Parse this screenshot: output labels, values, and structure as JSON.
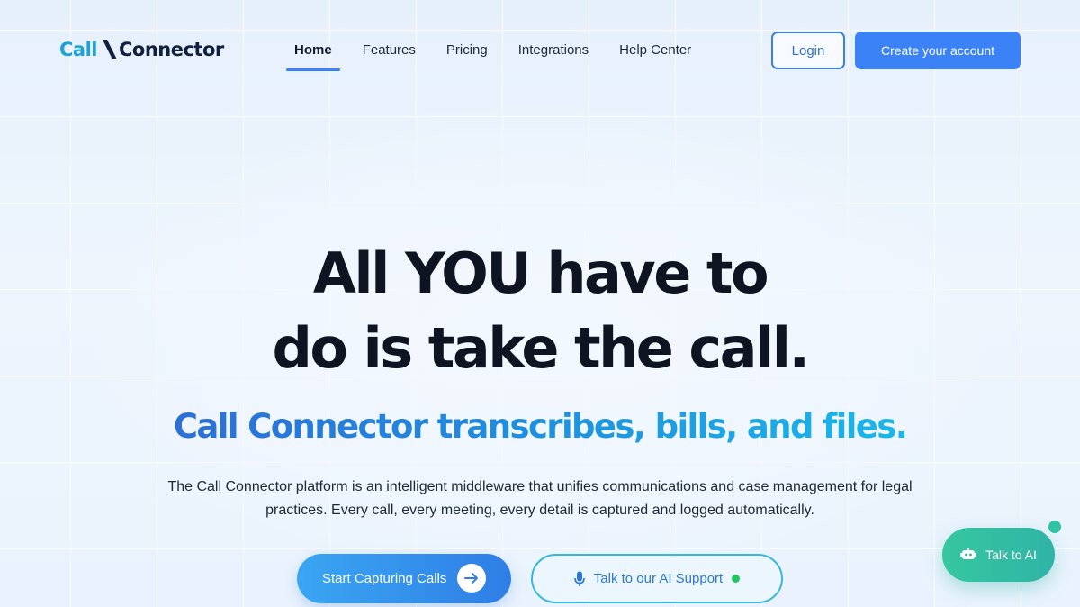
{
  "header": {
    "logo": {
      "part1": "Call",
      "part2": "Connector",
      "icon": "backslash-logo-mark"
    },
    "nav": [
      {
        "label": "Home",
        "active": true
      },
      {
        "label": "Features",
        "active": false
      },
      {
        "label": "Pricing",
        "active": false
      },
      {
        "label": "Integrations",
        "active": false
      },
      {
        "label": "Help Center",
        "active": false
      }
    ],
    "login_label": "Login",
    "create_account_label": "Create your account"
  },
  "hero": {
    "title_line1": "All YOU have to",
    "title_line2": "do is take the call.",
    "subtitle": "Call Connector transcribes, bills, and files.",
    "description_line1": "The Call Connector platform is an intelligent middleware that unifies communications and case management for legal",
    "description_line2": "practices. Every call, every meeting, every detail is captured and logged automatically.",
    "cta_primary": {
      "label": "Start Capturing Calls",
      "icon": "arrow-right-icon"
    },
    "cta_secondary": {
      "label": "Talk to our AI Support",
      "icon": "microphone-icon",
      "status": "online"
    }
  },
  "chat_widget": {
    "label": "Talk to AI",
    "icon": "robot-icon"
  },
  "colors": {
    "accent": "#3b82f6",
    "logo_call": "#1ea1d8",
    "logo_connector": "#10203f",
    "heading": "#0f1422",
    "ai_widget": "#36c7a0",
    "online": "#22c55e"
  }
}
